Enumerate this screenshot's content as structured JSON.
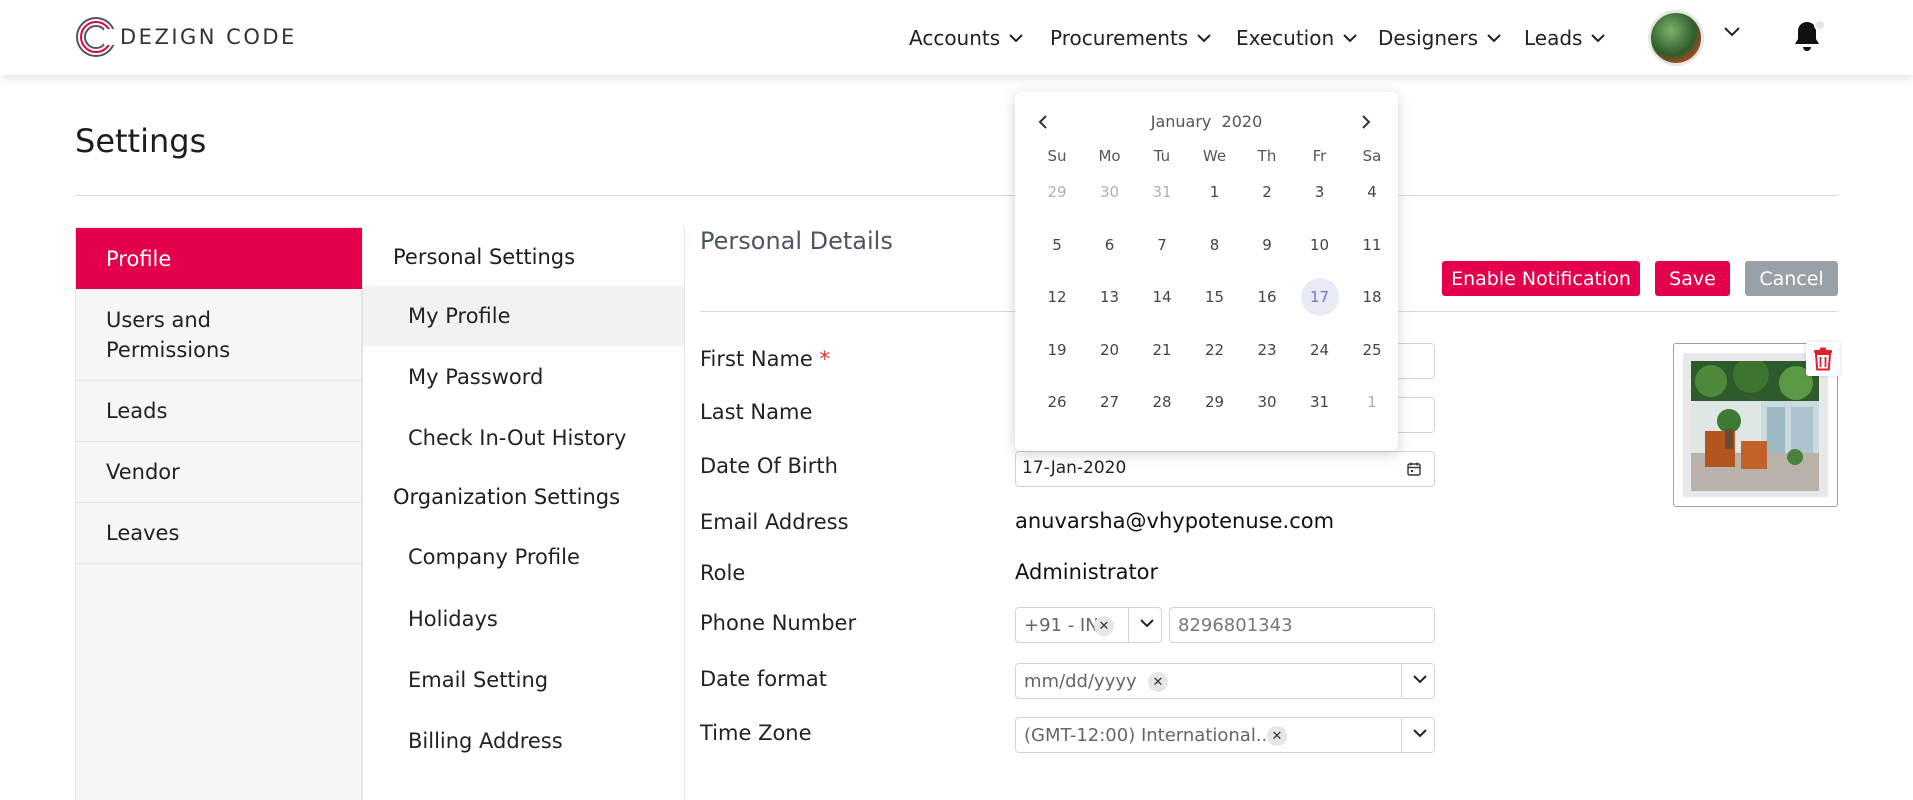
{
  "brand": {
    "name": "DEZIGN CODE"
  },
  "nav": {
    "items": [
      "Accounts",
      "Procurements",
      "Execution",
      "Designers",
      "Leads"
    ]
  },
  "page": {
    "title": "Settings"
  },
  "sidebar": {
    "items": [
      "Profile",
      "Users and Permissions",
      "Leads",
      "Vendor",
      "Leaves"
    ],
    "active": "Profile"
  },
  "submenu": {
    "personal_heading": "Personal Settings",
    "personal_items": [
      "My Profile",
      "My Password",
      "Check In-Out History"
    ],
    "org_heading": "Organization Settings",
    "org_items": [
      "Company Profile",
      "Holidays",
      "Email Setting",
      "Billing Address"
    ]
  },
  "section": {
    "title": "Personal Details"
  },
  "buttons": {
    "notify": "Enable Notification",
    "save": "Save",
    "cancel": "Cancel"
  },
  "form": {
    "first_name_label": "First Name",
    "required_mark": "*",
    "last_name_label": "Last Name",
    "dob_label": "Date Of Birth",
    "dob_value": "17-Jan-2020",
    "email_label": "Email Address",
    "email_value": "anuvarsha@vhypotenuse.com",
    "role_label": "Role",
    "role_value": "Administrator",
    "phone_label": "Phone Number",
    "phone_code": "+91 - IN",
    "phone_value": "8296801343",
    "date_format_label": "Date format",
    "date_format_value": "mm/dd/yyyy",
    "timezone_label": "Time Zone",
    "timezone_value": "(GMT-12:00) International..."
  },
  "calendar": {
    "month": "January",
    "year": "2020",
    "weekdays": [
      "Su",
      "Mo",
      "Tu",
      "We",
      "Th",
      "Fr",
      "Sa"
    ],
    "weeks": [
      [
        "29",
        "30",
        "31",
        "1",
        "2",
        "3",
        "4"
      ],
      [
        "5",
        "6",
        "7",
        "8",
        "9",
        "10",
        "11"
      ],
      [
        "12",
        "13",
        "14",
        "15",
        "16",
        "17",
        "18"
      ],
      [
        "19",
        "20",
        "21",
        "22",
        "23",
        "24",
        "25"
      ],
      [
        "26",
        "27",
        "28",
        "29",
        "30",
        "31",
        "1"
      ]
    ],
    "selected_day": "17"
  },
  "colors": {
    "accent": "#e5004c",
    "cancel": "#9aa0a8",
    "selected_day_bg": "#e8ebf6"
  },
  "icons": [
    "logo-ring-icon",
    "chevron-down-icon",
    "bell-icon",
    "calendar-icon",
    "close-icon",
    "trash-icon",
    "chevron-left-icon",
    "chevron-right-icon"
  ]
}
